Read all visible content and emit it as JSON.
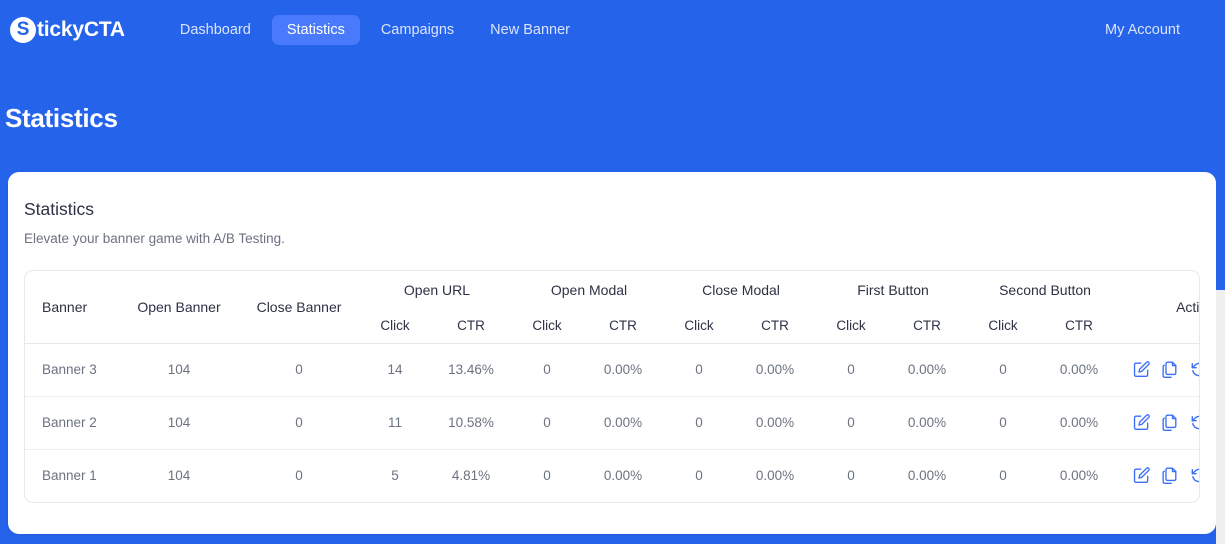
{
  "navbar": {
    "brand_initial": "S",
    "brand_rest": "tickyCTA",
    "links": [
      {
        "label": "Dashboard",
        "active": false
      },
      {
        "label": "Statistics",
        "active": true
      },
      {
        "label": "Campaigns",
        "active": false
      },
      {
        "label": "New Banner",
        "active": false
      }
    ],
    "account_label": "My Account"
  },
  "page": {
    "title": "Statistics"
  },
  "card": {
    "title": "Statistics",
    "subtitle": "Elevate your banner game with A/B Testing."
  },
  "table": {
    "group_headers": [
      "Banner",
      "Open Banner",
      "Close Banner",
      "Open URL",
      "Open Modal",
      "Close Modal",
      "First Button",
      "Second Button",
      "Actions"
    ],
    "sub_headers": {
      "click": "Click",
      "ctr": "CTR"
    },
    "rows": [
      {
        "banner": "Banner 3",
        "open_banner": "104",
        "close_banner": "0",
        "open_url_click": "14",
        "open_url_ctr": "13.46%",
        "open_modal_click": "0",
        "open_modal_ctr": "0.00%",
        "close_modal_click": "0",
        "close_modal_ctr": "0.00%",
        "first_button_click": "0",
        "first_button_ctr": "0.00%",
        "second_button_click": "0",
        "second_button_ctr": "0.00%"
      },
      {
        "banner": "Banner 2",
        "open_banner": "104",
        "close_banner": "0",
        "open_url_click": "11",
        "open_url_ctr": "10.58%",
        "open_modal_click": "0",
        "open_modal_ctr": "0.00%",
        "close_modal_click": "0",
        "close_modal_ctr": "0.00%",
        "first_button_click": "0",
        "first_button_ctr": "0.00%",
        "second_button_click": "0",
        "second_button_ctr": "0.00%"
      },
      {
        "banner": "Banner 1",
        "open_banner": "104",
        "close_banner": "0",
        "open_url_click": "5",
        "open_url_ctr": "4.81%",
        "open_modal_click": "0",
        "open_modal_ctr": "0.00%",
        "close_modal_click": "0",
        "close_modal_ctr": "0.00%",
        "first_button_click": "0",
        "first_button_ctr": "0.00%",
        "second_button_click": "0",
        "second_button_ctr": "0.00%"
      }
    ],
    "row_action_icons": [
      "edit-icon",
      "copy-icon",
      "refresh-icon",
      "delete-icon",
      "view-icon"
    ]
  },
  "colors": {
    "brand_blue": "#2563eb",
    "active_tab_blue": "#4a7afc",
    "icon_blue": "#3b6ef5",
    "text_dark": "#2c3244",
    "text_muted": "#6b7280",
    "card_white": "#ffffff"
  }
}
